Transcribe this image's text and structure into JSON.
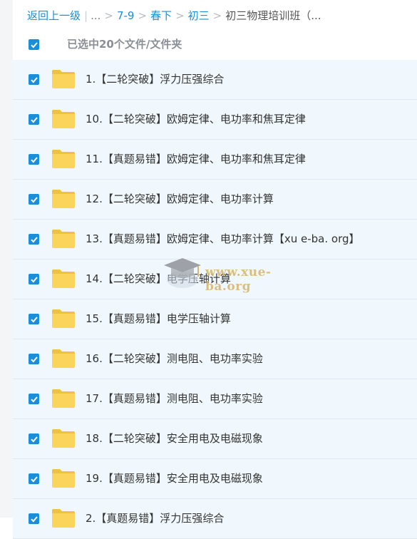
{
  "breadcrumb": {
    "back_label": "返回上一级",
    "ellipsis": "...",
    "crumbs": [
      "7-9",
      "春下",
      "初三"
    ],
    "current": "初三物理培训班（..."
  },
  "selection": {
    "count_text": "已选中20个文件/文件夹"
  },
  "watermark": {
    "text": "www.xue-ba.org"
  },
  "files": [
    {
      "name": "1.【二轮突破】浮力压强综合"
    },
    {
      "name": "10.【二轮突破】欧姆定律、电功率和焦耳定律"
    },
    {
      "name": "11.【真题易错】欧姆定律、电功率和焦耳定律"
    },
    {
      "name": "12.【二轮突破】欧姆定律、电功率计算"
    },
    {
      "name": "13.【真题易错】欧姆定律、电功率计算【xu e-ba. org】"
    },
    {
      "name": "14.【二轮突破】电学压轴计算"
    },
    {
      "name": "15.【真题易错】电学压轴计算"
    },
    {
      "name": "16.【二轮突破】测电阻、电功率实验"
    },
    {
      "name": "17.【真题易错】测电阻、电功率实验"
    },
    {
      "name": "18.【二轮突破】安全用电及电磁现象"
    },
    {
      "name": "19.【真题易错】安全用电及电磁现象"
    },
    {
      "name": "2.【真题易错】浮力压强综合"
    }
  ],
  "colors": {
    "accent": "#1a8ed8",
    "row_bg": "#f0f8fd",
    "folder": "#fbd55b"
  }
}
